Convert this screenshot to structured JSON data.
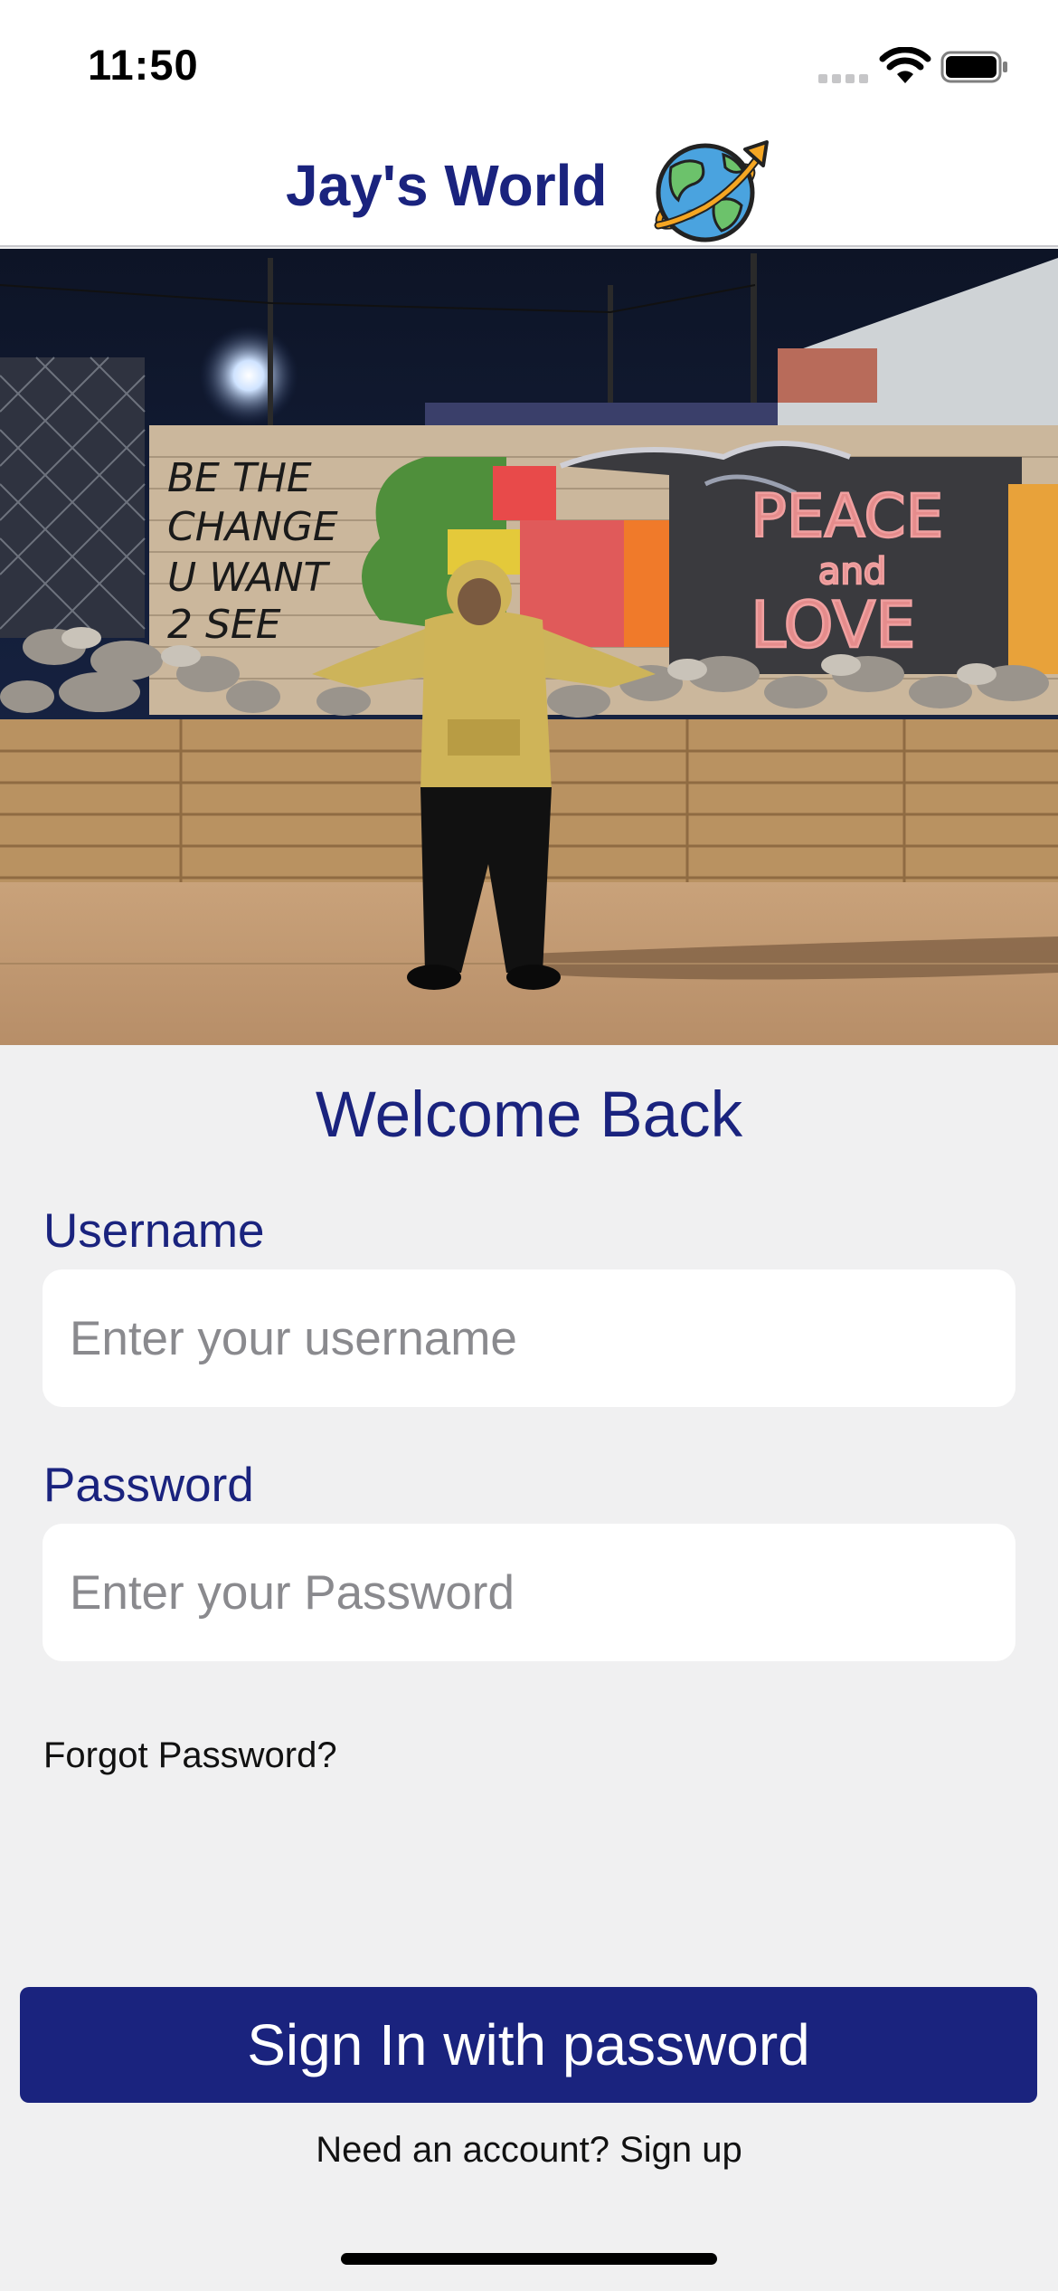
{
  "status_bar": {
    "time": "11:50",
    "icons": [
      "cellular-signal-icon",
      "wifi-icon",
      "battery-icon"
    ]
  },
  "header": {
    "title": "Jay's World",
    "logo_icon": "globe-planet-icon"
  },
  "hero": {
    "image_subject": "person-in-front-of-graffiti-wall-photo",
    "wall_text_left": [
      "BE THE",
      "CHANGE",
      "U WANT",
      "2 SEE"
    ],
    "wall_text_right": [
      "PEACE",
      "and",
      "LOVE"
    ]
  },
  "form": {
    "welcome": "Welcome Back",
    "username_label": "Username",
    "username_placeholder": "Enter your username",
    "username_value": "",
    "password_label": "Password",
    "password_placeholder": "Enter your Password",
    "password_value": "",
    "forgot_password": "Forgot Password?",
    "sign_in_button": "Sign In with password",
    "signup_prompt": "Need an account? Sign up"
  },
  "colors": {
    "primary": "#1a237e",
    "background": "#f0f0f1",
    "input_background": "#ffffff"
  }
}
